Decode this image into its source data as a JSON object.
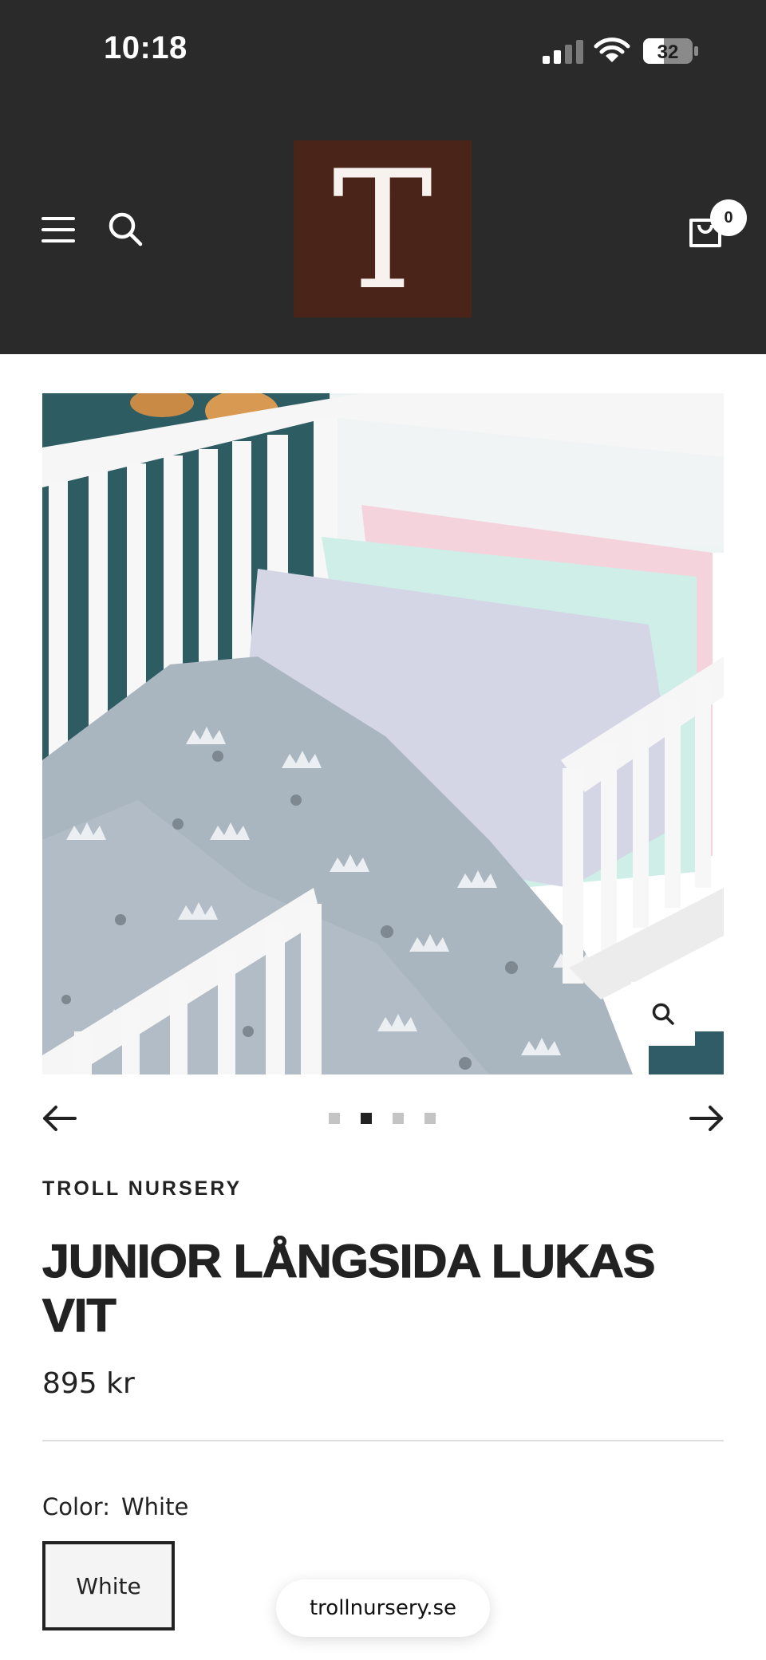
{
  "status_bar": {
    "time": "10:18",
    "battery_level": "32"
  },
  "header": {
    "logo_letter": "T",
    "cart_count": "0",
    "icons": [
      "menu-icon",
      "search-icon",
      "cart-icon"
    ],
    "background_color": "#2a2a2a",
    "logo_color": "#4b2419"
  },
  "gallery": {
    "slide_count": 4,
    "active_slide": 2,
    "prev_icon": "arrow-left-icon",
    "next_icon": "arrow-right-icon",
    "zoom_icon": "search-icon"
  },
  "product": {
    "brand": "TROLL NURSERY",
    "title_line1": "JUNIOR LÅNGSIDA LUKAS",
    "title_line2": "VIT",
    "price": "895 kr",
    "color_label": "Color:",
    "color_value": "White",
    "swatch_label": "White"
  },
  "browser": {
    "url": "trollnursery.se"
  }
}
